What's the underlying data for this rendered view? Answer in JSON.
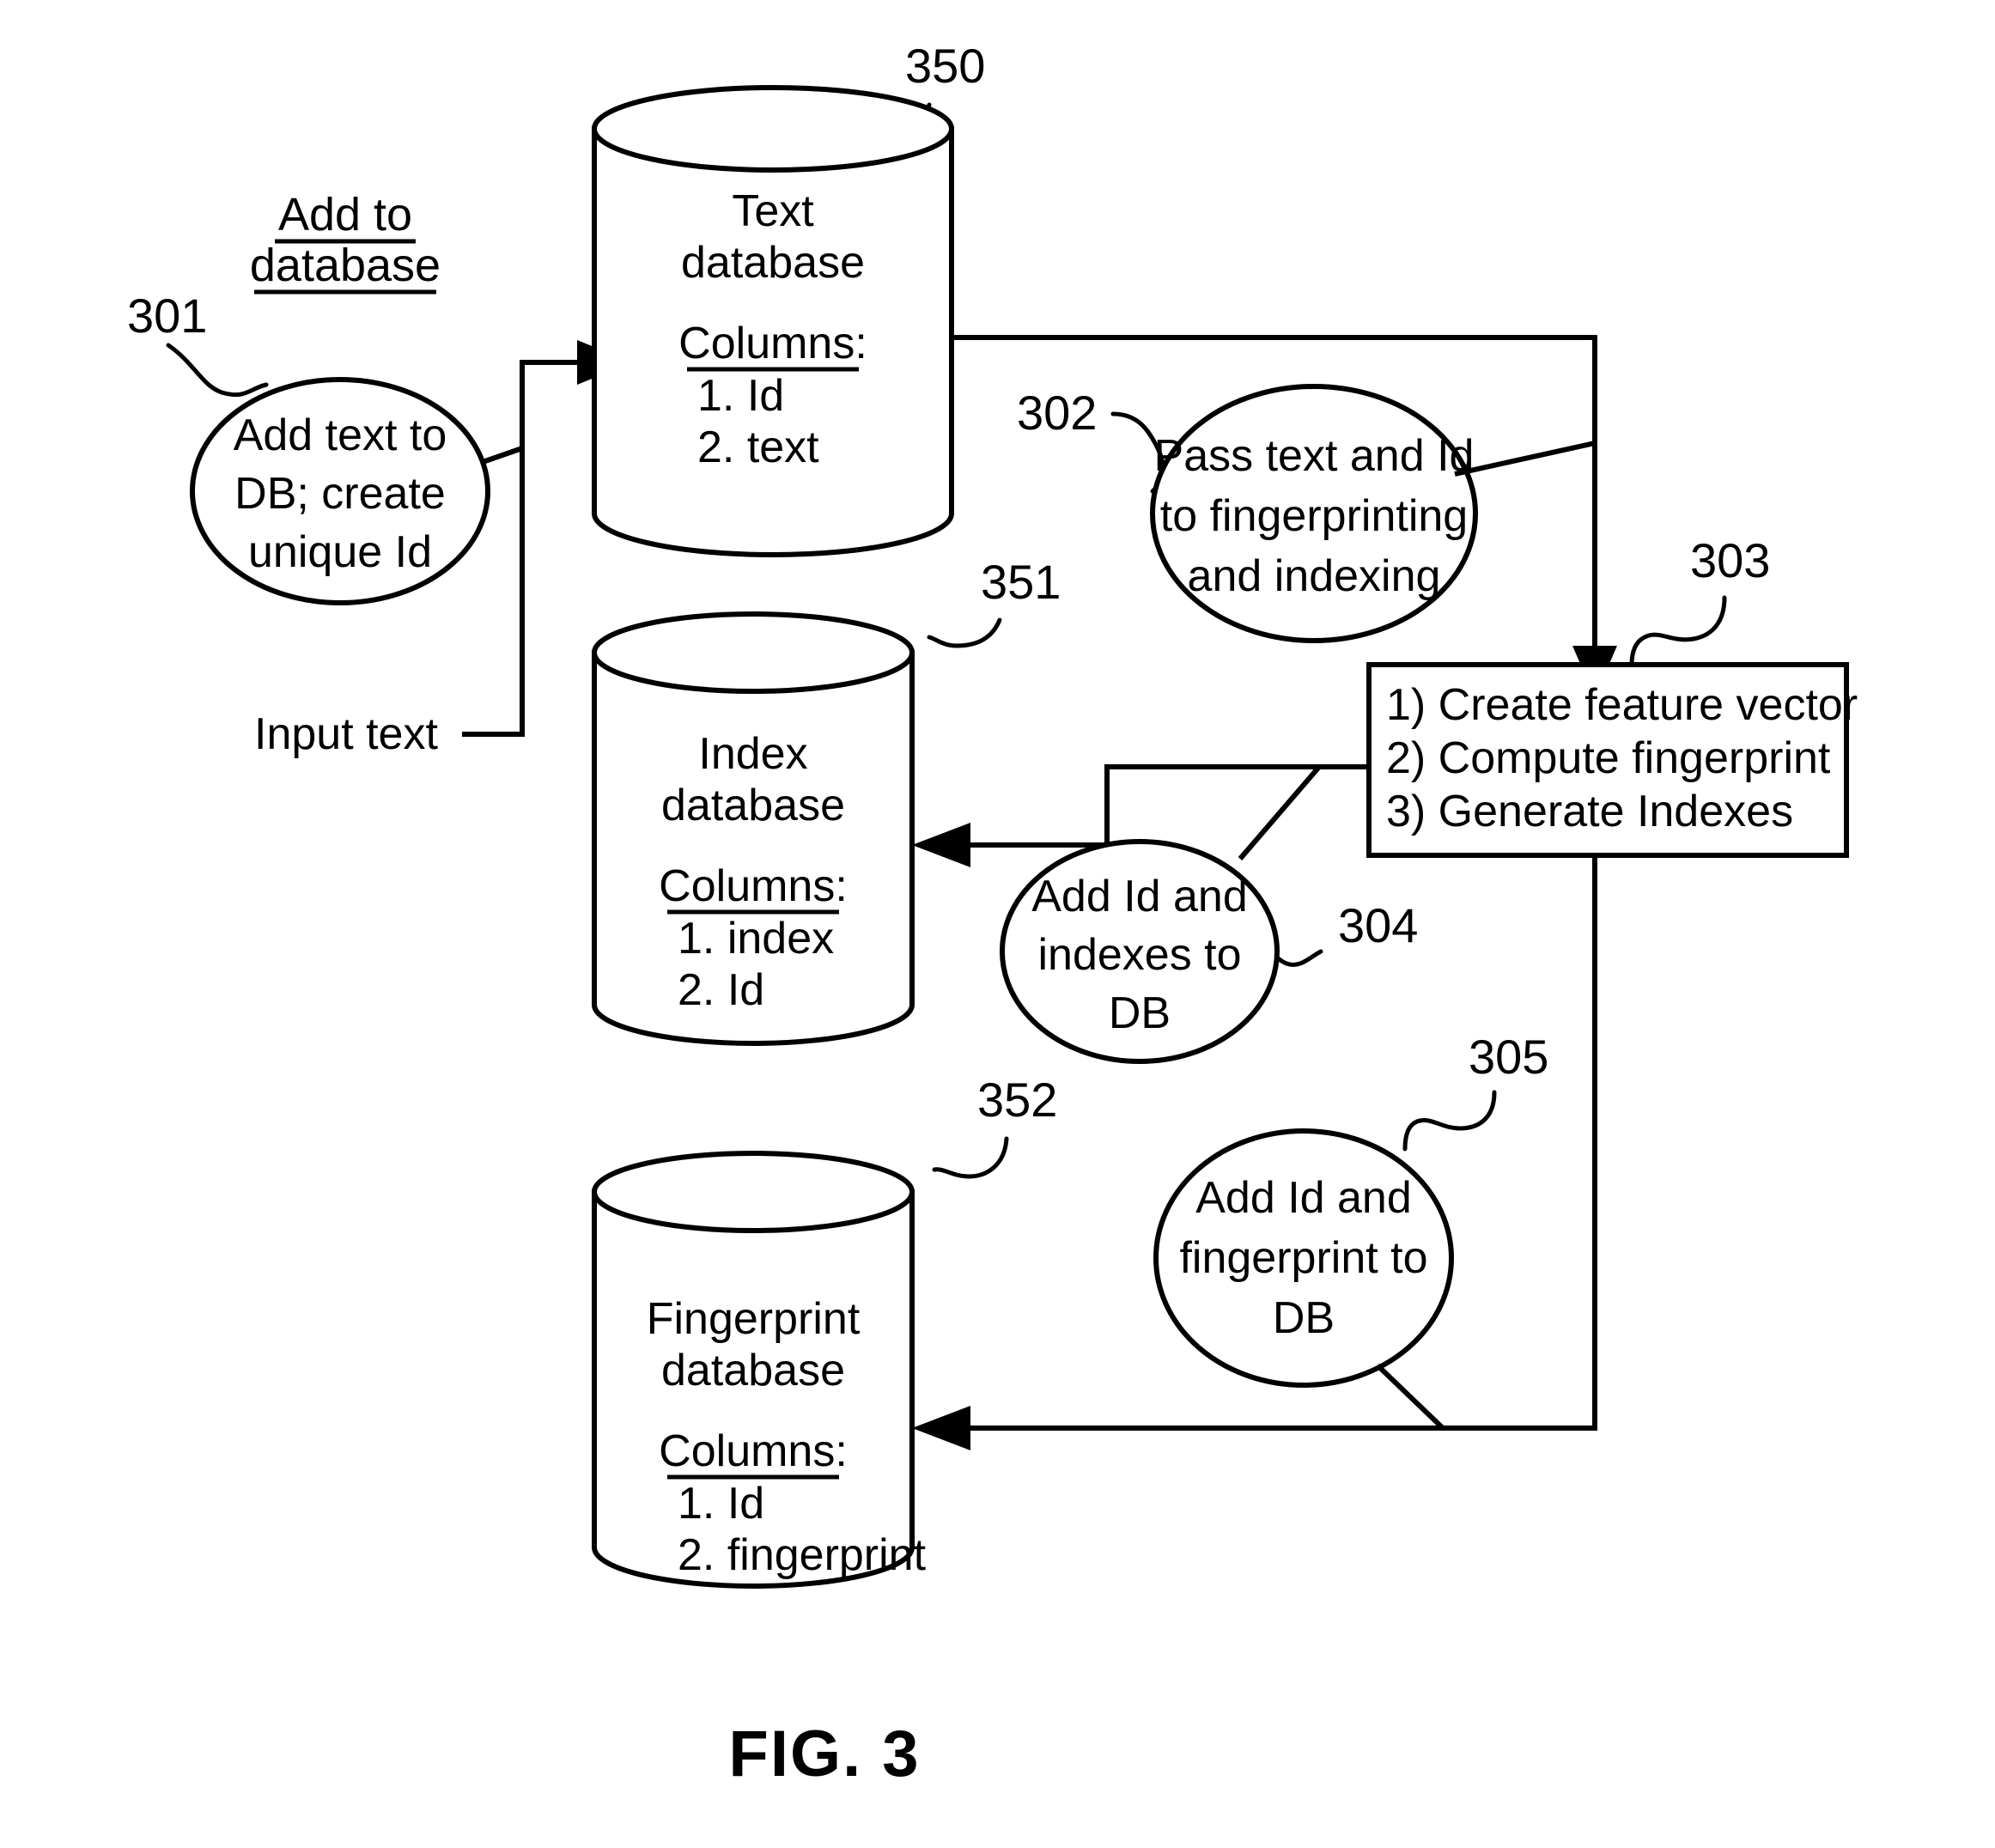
{
  "figure": {
    "caption": "FIG. 3",
    "section_header": {
      "line1": "Add to",
      "line2": "database"
    },
    "input_label": "Input text"
  },
  "process_nodes": [
    {
      "ref": "301",
      "name": "add-text-node",
      "lines": [
        "Add text to",
        "DB; create",
        "unique Id"
      ]
    },
    {
      "ref": "302",
      "name": "pass-text-node",
      "lines": [
        "Pass text and Id",
        "to fingerprinting",
        "and indexing"
      ]
    },
    {
      "ref": "304",
      "name": "add-index-node",
      "lines": [
        "Add Id and",
        "indexes to",
        "DB"
      ]
    },
    {
      "ref": "305",
      "name": "add-fingerprint-node",
      "lines": [
        "Add Id and",
        "fingerprint to",
        "DB"
      ]
    }
  ],
  "process_box": {
    "ref": "303",
    "steps": [
      "1) Create feature vector",
      "2) Compute fingerprint",
      "3) Generate Indexes"
    ]
  },
  "databases": [
    {
      "ref": "350",
      "name": "text-database",
      "title_line1": "Text",
      "title_line2": "database",
      "columns_header": "Columns:",
      "columns": [
        "1. Id",
        "2. text"
      ]
    },
    {
      "ref": "351",
      "name": "index-database",
      "title_line1": "Index",
      "title_line2": "database",
      "columns_header": "Columns:",
      "columns": [
        "1. index",
        "2. Id"
      ]
    },
    {
      "ref": "352",
      "name": "fingerprint-database",
      "title_line1": "Fingerprint",
      "title_line2": "database",
      "columns_header": "Columns:",
      "columns": [
        "1. Id",
        "2. fingerprint"
      ]
    }
  ],
  "chart_data": {
    "type": "diagram",
    "title": "FIG. 3",
    "nodes": [
      {
        "id": "301",
        "shape": "ellipse",
        "label": "Add text to DB; create unique Id"
      },
      {
        "id": "350",
        "shape": "cylinder",
        "label": "Text database"
      },
      {
        "id": "302",
        "shape": "ellipse",
        "label": "Pass text and Id to fingerprinting and indexing"
      },
      {
        "id": "303",
        "shape": "rect",
        "label": "1) Create feature vector 2) Compute fingerprint 3) Generate Indexes"
      },
      {
        "id": "351",
        "shape": "cylinder",
        "label": "Index database"
      },
      {
        "id": "304",
        "shape": "ellipse",
        "label": "Add Id and indexes to DB"
      },
      {
        "id": "352",
        "shape": "cylinder",
        "label": "Fingerprint database"
      },
      {
        "id": "305",
        "shape": "ellipse",
        "label": "Add Id and fingerprint to DB"
      }
    ],
    "edges": [
      {
        "from": "Input text",
        "to": "350",
        "label": "301"
      },
      {
        "from": "350",
        "to": "303",
        "label": "302"
      },
      {
        "from": "303",
        "to": "351",
        "label": "304"
      },
      {
        "from": "303",
        "to": "352",
        "label": "305"
      }
    ]
  }
}
